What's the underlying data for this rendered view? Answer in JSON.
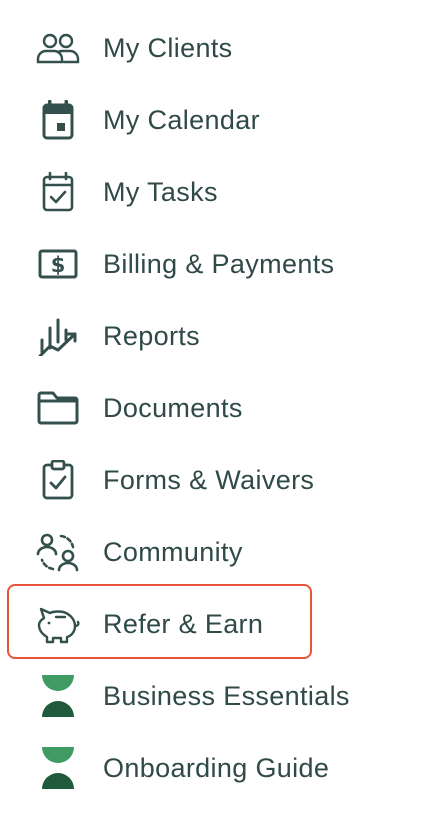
{
  "nav": {
    "items": [
      {
        "label": "My Clients",
        "icon": "clients-icon"
      },
      {
        "label": "My Calendar",
        "icon": "calendar-icon"
      },
      {
        "label": "My Tasks",
        "icon": "tasks-icon"
      },
      {
        "label": "Billing & Payments",
        "icon": "billing-icon"
      },
      {
        "label": "Reports",
        "icon": "reports-icon"
      },
      {
        "label": "Documents",
        "icon": "folder-icon"
      },
      {
        "label": "Forms & Waivers",
        "icon": "clipboard-icon"
      },
      {
        "label": "Community",
        "icon": "community-icon"
      },
      {
        "label": "Refer & Earn",
        "icon": "piggy-bank-icon"
      },
      {
        "label": "Business Essentials",
        "icon": "brand-logo-icon"
      },
      {
        "label": "Onboarding Guide",
        "icon": "brand-logo-icon"
      }
    ],
    "highlighted_item": "Refer & Earn"
  },
  "colors": {
    "text": "#2f4a47",
    "icon": "#34504c",
    "highlight_border": "#e4553a",
    "logo_top": "#3f9a63",
    "logo_bottom": "#1f5a3a"
  }
}
